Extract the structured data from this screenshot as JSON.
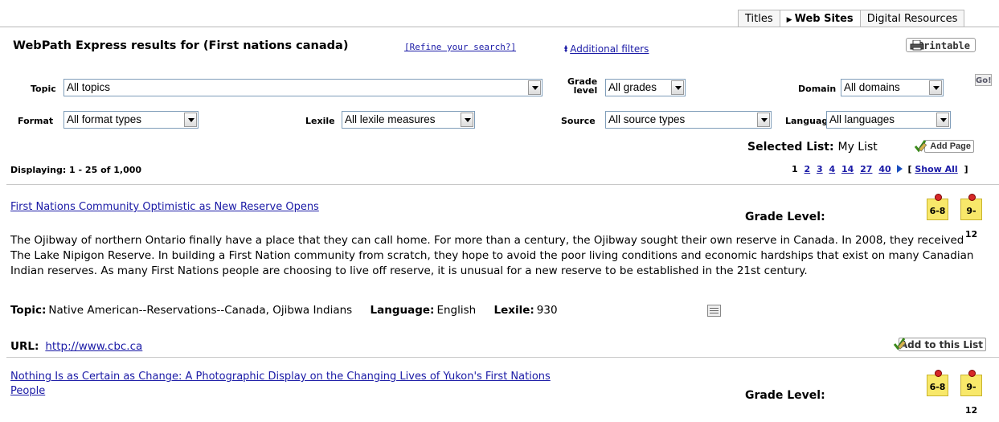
{
  "tabs": [
    {
      "label": "Titles"
    },
    {
      "label": "Web Sites"
    },
    {
      "label": "Digital Resources"
    }
  ],
  "header": {
    "title": "WebPath Express results for (First nations canada)",
    "refine": "[Refine your search?]",
    "filters": "Additional filters",
    "printable": "Printable"
  },
  "filters": {
    "topic": {
      "label": "Topic",
      "value": "All topics"
    },
    "grade": {
      "label1": "Grade",
      "label2": "level",
      "value": "All grades"
    },
    "domain": {
      "label": "Domain",
      "value": "All domains"
    },
    "go": "Go!",
    "format": {
      "label": "Format",
      "value": "All format types"
    },
    "lexile": {
      "label": "Lexile",
      "value": "All lexile measures"
    },
    "source": {
      "label": "Source",
      "value": "All source types"
    },
    "language": {
      "label": "Language",
      "value": "All languages"
    }
  },
  "selected_list": {
    "label": "Selected List:",
    "name": "My List",
    "add_page": "Add Page"
  },
  "results_info": {
    "displaying": "Displaying: 1 - 25 of 1,000",
    "current_page": "1",
    "pages": [
      "2",
      "3",
      "4",
      "14",
      "27",
      "40"
    ],
    "show_all_open": "[",
    "show_all": "Show All",
    "show_all_close": "]"
  },
  "results": [
    {
      "title": "First Nations Community Optimistic as New Reserve Opens",
      "grade_label": "Grade Level:",
      "grades": [
        "6-8",
        "9-12"
      ],
      "description": "The Ojibway of northern Ontario finally have a place that they can call home. For more than a century, the Ojibway sought their own reserve in Canada. In 2008, they received The Lake Nipigon Reserve. In building a First Nation community from scratch, they hope to avoid the poor living conditions and economic hardships that exist on many Canadian Indian reserves. As many First Nations people are choosing to live off reserve, it is unusual for a new reserve to be established in the 21st century.",
      "topic_label": "Topic:",
      "topic": "Native American--Reservations--Canada, Ojibwa Indians",
      "language_label": "Language:",
      "language": "English",
      "lexile_label": "Lexile:",
      "lexile": "930",
      "url_label": "URL:",
      "url": "http://www.cbc.ca",
      "add_to_list": "Add to this List"
    },
    {
      "title_line1": "Nothing Is as Certain as Change: A Photographic Display on the Changing Lives of Yukon's First Nations",
      "title_line2": "People",
      "grade_label": "Grade Level:",
      "grades": [
        "6-8",
        "9-12"
      ]
    }
  ]
}
